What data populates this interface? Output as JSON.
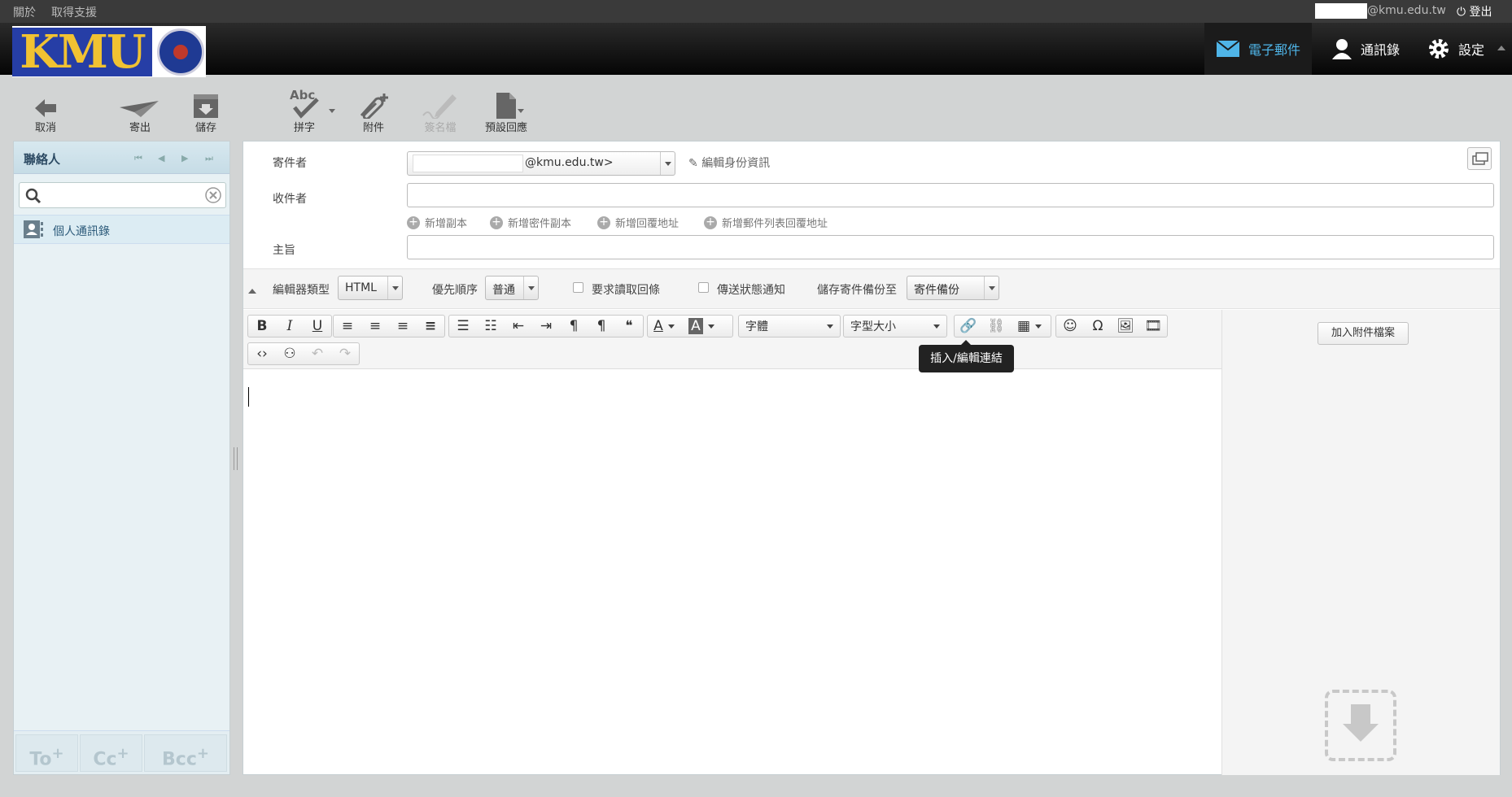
{
  "topbar": {
    "about": "關於",
    "support": "取得支援",
    "user_domain": "@kmu.edu.tw",
    "logout": "登出"
  },
  "logo": {
    "text": "KMU"
  },
  "nav": {
    "mail": "電子郵件",
    "contacts": "通訊錄",
    "settings": "設定"
  },
  "toolbar": {
    "cancel": "取消",
    "send": "寄出",
    "save": "儲存",
    "spell": "拼字",
    "attach": "附件",
    "signature": "簽名檔",
    "responses": "預設回應"
  },
  "sidebar": {
    "title": "聯絡人",
    "address_book": "個人通訊錄",
    "to": "To",
    "cc": "Cc",
    "bcc": "Bcc",
    "plus": "+"
  },
  "compose": {
    "from_label": "寄件者",
    "from_value": "@kmu.edu.tw>",
    "edit_identity": "編輯身份資訊",
    "to_label": "收件者",
    "add_cc": "新增副本",
    "add_bcc": "新增密件副本",
    "add_reply_to": "新增回覆地址",
    "add_followup_to": "新增郵件列表回覆地址",
    "subject_label": "主旨",
    "editor_type_label": "編輯器類型",
    "editor_type_value": "HTML",
    "priority_label": "優先順序",
    "priority_value": "普通",
    "read_receipt_label": "要求讀取回條",
    "dsn_label": "傳送狀態通知",
    "store_label": "儲存寄件備份至",
    "store_value": "寄件備份"
  },
  "editor": {
    "bold": "B",
    "italic": "I",
    "underline": "U",
    "font_family": "字體",
    "font_size": "字型大小",
    "tooltip": "插入/編輯連結"
  },
  "attachments": {
    "add_button": "加入附件檔案"
  }
}
